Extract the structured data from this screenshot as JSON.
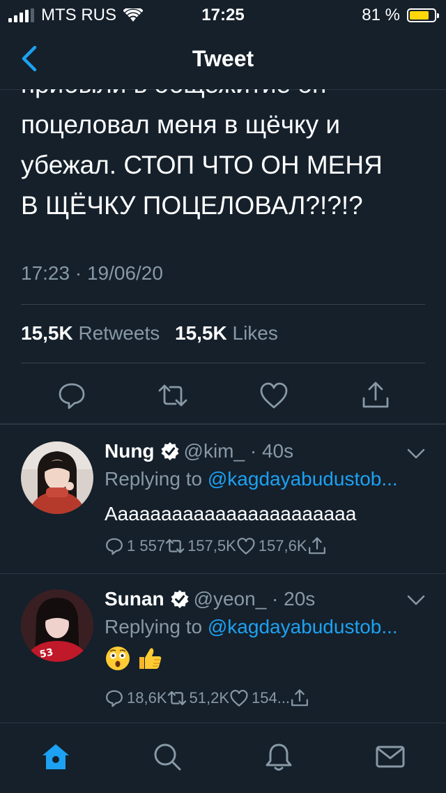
{
  "status": {
    "carrier": "MTS RUS",
    "time": "17:25",
    "battery": "81 %",
    "battery_level": 0.81
  },
  "nav": {
    "title": "Tweet"
  },
  "tweet": {
    "text_lines": [
      "прибыли в общежитие он",
      "поцеловал меня в щёчку и",
      "убежал. СТОП ЧТО ОН МЕНЯ",
      "В ЩЁЧКУ ПОЦЕЛОВАЛ?!?!?"
    ],
    "timestamp": "17:23 · 19/06/20",
    "retweets_count": "15,5K",
    "retweets_label": "Retweets",
    "likes_count": "15,5K",
    "likes_label": "Likes"
  },
  "replies": [
    {
      "name": "Nung",
      "handle": "@kim_ · 40s",
      "replying_label": "Replying to",
      "replying_to": "@kagdayabudustob...",
      "text": "Aaaaaaaaaaaaaaaaaaaaaaa",
      "reply_count": "1 557",
      "retweet_count": "157,5K",
      "like_count": "157,6K"
    },
    {
      "name": "Sunan",
      "handle": "@yeon_ · 20s",
      "replying_label": "Replying to",
      "replying_to": "@kagdayabudustob...",
      "text": "",
      "emoji": [
        "astonished-face",
        "thumbs-up"
      ],
      "reply_count": "18,6K",
      "retweet_count": "51,2K",
      "like_count": "154..."
    }
  ],
  "colors": {
    "background": "#15202b",
    "accent": "#1da1f2",
    "muted": "#8899a6",
    "divider": "#38444d"
  }
}
